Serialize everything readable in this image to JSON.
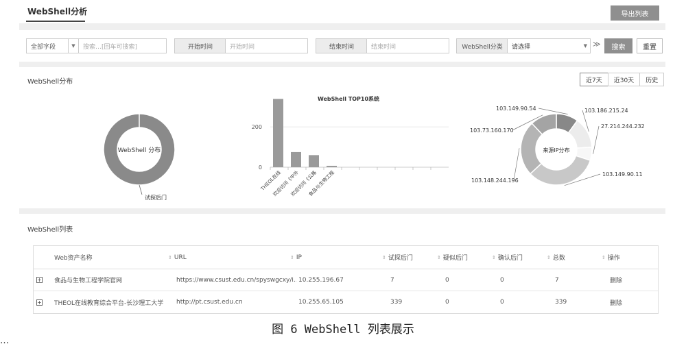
{
  "header": {
    "tab": "WebShell分析",
    "export_label": "导出列表"
  },
  "filters": {
    "field_select": "全部字段",
    "search_placeholder": "搜索…[回车可搜索]",
    "start_label": "开始时间",
    "start_placeholder": "开始时间",
    "end_label": "结束时间",
    "end_placeholder": "结束时间",
    "category_label": "WebShell分类",
    "category_value": "请选择",
    "search_button": "搜索",
    "reset_button": "重置"
  },
  "distribution": {
    "title": "WebShell分布",
    "ranges": [
      "近7天",
      "近30天",
      "历史"
    ],
    "active_range": "近7天"
  },
  "chart_data": [
    {
      "type": "pie",
      "title": "WebShell 分布",
      "labels": [
        "试探后门"
      ],
      "values": [
        2
      ]
    },
    {
      "type": "bar",
      "title": "WebShell TOP10系统",
      "categories": [
        "THEOL在线",
        "欢迎访问《中外",
        "欢迎访问《公路",
        "食品与生物工程"
      ],
      "values": [
        339,
        75,
        60,
        7
      ],
      "yticks": [
        0,
        200
      ],
      "ylim": [
        0,
        340
      ]
    },
    {
      "type": "pie",
      "title": "来源IP分布",
      "labels": [
        "103.149.90.54",
        "103.186.215.24",
        "27.214.244.232",
        "103.149.90.11",
        "103.148.244.196",
        "103.73.160.170"
      ],
      "values": [
        10,
        14,
        6,
        33,
        25,
        12
      ],
      "colors": [
        "#888888",
        "#ececec",
        "#f7f7f7",
        "#c8c8c8",
        "#b4b4b4",
        "#a4a4a4"
      ]
    }
  ],
  "list": {
    "title": "WebShell列表",
    "columns": [
      "Web资产名称",
      "URL",
      "IP",
      "试探后门",
      "疑似后门",
      "确认后门",
      "总数",
      "操作"
    ],
    "rows": [
      {
        "name": "食品与生物工程学院官网",
        "url": "https://www.csust.edu.cn/spyswgcxy/i...",
        "ip": "10.255.196.67",
        "probe": "7",
        "suspect": "0",
        "confirm": "0",
        "total": "7",
        "action": "删除"
      },
      {
        "name": "THEOL在线教育综合平台-长沙理工大学",
        "url": "http://pt.csust.edu.cn",
        "ip": "10.255.65.105",
        "probe": "339",
        "suspect": "0",
        "confirm": "0",
        "total": "339",
        "action": "删除"
      }
    ]
  },
  "caption": "图 6  WebShell 列表展示",
  "footer_text": "…"
}
